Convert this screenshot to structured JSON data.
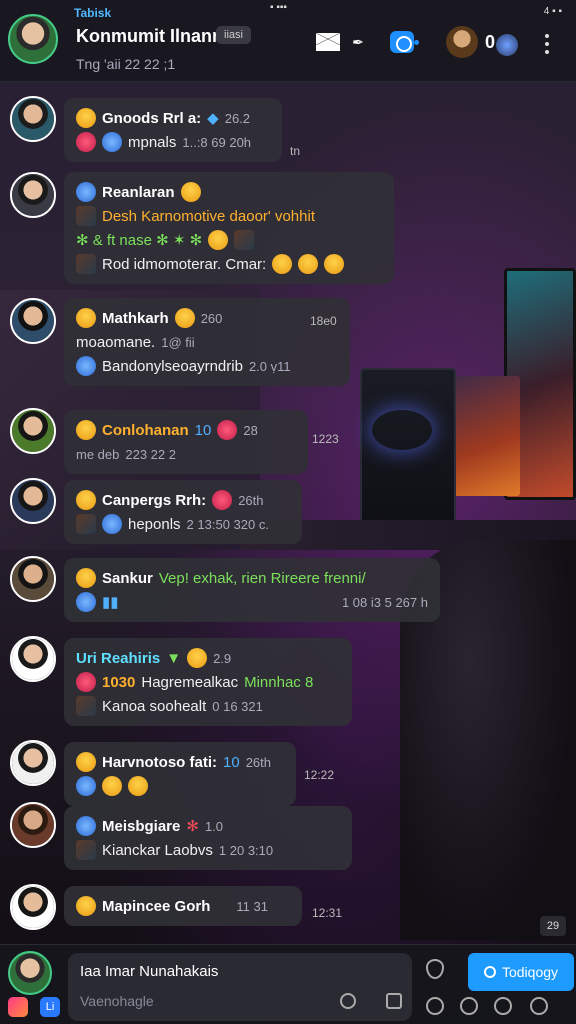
{
  "status_bar": {
    "left": "Tabisk",
    "mid": "▪ ▪▪▪",
    "right": "4 ▪ ▪"
  },
  "header": {
    "title": "Konmumit Ilnannan:",
    "title_chip": "iiasi",
    "subtitle": "Tng 'aii 22 22 ;1",
    "peer_count": "0"
  },
  "messages": [
    {
      "sender": "Gnoods Rrl a:",
      "badge": "26.2",
      "line2": "mpnals",
      "meta2": "1..:8 69 20h",
      "time": "tn"
    },
    {
      "sender": "Reanlaran",
      "line2": "Desh Karnomotive daoor' vohhit",
      "line3": "✻ & ft nase ✻ ✶ ✻",
      "line4": "Rod idmomoterar. Cmar:"
    },
    {
      "sender": "Mathkarh",
      "badge": "260",
      "time": "18e0",
      "line2": "moaomane.",
      "meta2": "1@ fii",
      "line3": "Bandonylseoayrndrib",
      "meta3": "2.0 ṿ11"
    },
    {
      "sender": "Conlohanan",
      "badge": "10",
      "meta1": "28",
      "time": "1223",
      "line2": "me deb",
      "meta2": "223 22 2"
    },
    {
      "sender": "Canpergs Rrh:",
      "badge": "26th",
      "line2": "heponls",
      "meta2": "2 13:50 320 c."
    },
    {
      "sender": "Sankur",
      "line1_green": "Vep! exhak, rien Rireere frenni/",
      "meta2": "1 08 i3 5 267 h"
    },
    {
      "sender": "Uri Reahiris",
      "badge": "2.9",
      "line2_orange": "1030",
      "line2": "Hagremealkac",
      "line2_green": "Minnhac 8",
      "line3": "Kanoa soohealt",
      "meta3": "0 16 321"
    },
    {
      "sender": "Harvnotoso fati:",
      "badge": "10",
      "meta1": "26th",
      "time": "12:22"
    },
    {
      "sender": "Meisbgiare",
      "badge": "1.0",
      "line2": "Kianckar Laobvs",
      "meta2": "1 20 3:10"
    },
    {
      "sender": "Mapincee Gorh",
      "badge": "11 31",
      "time": "12:31"
    }
  ],
  "composer": {
    "label": "Iaa Imar Nunahakais",
    "placeholder": "Vaenohagle",
    "send_label": "Todiqogy",
    "small_badge": "Li"
  },
  "scroll_badge": "29"
}
